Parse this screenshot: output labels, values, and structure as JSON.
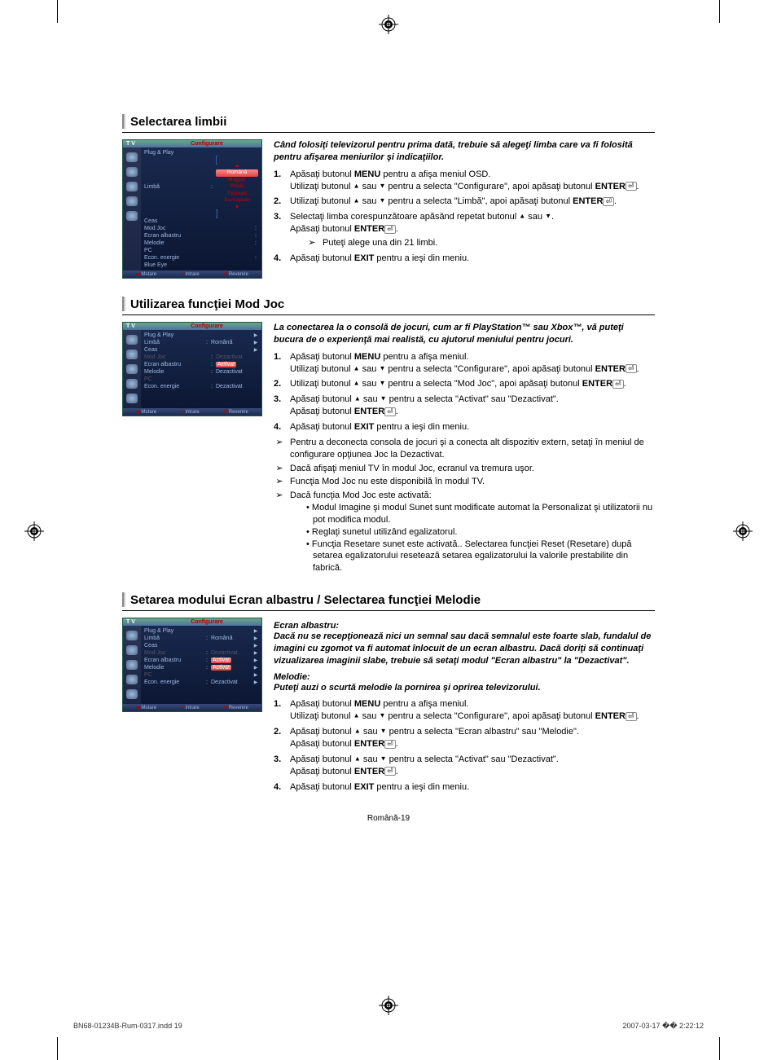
{
  "sections": {
    "s1": {
      "title": "Selectarea limbii",
      "intro": "Când folosiţi televizorul pentru prima dată, trebuie să alegeţi limba care va fi folosită pentru afişarea meniurilor şi indicaţiilor.",
      "step1a": "Apăsaţi butonul ",
      "step1b": " pentru a afişa meniul OSD.",
      "step1c": "Utilizaţi butonul ",
      "step1d": " sau ",
      "step1e": " pentru a selecta \"Configurare\", apoi apăsaţi butonul ",
      "step2a": "Utilizaţi butonul ",
      "step2b": " sau ",
      "step2c": " pentru a selecta \"Limbă\", apoi apăsaţi butonul ",
      "step3a": "Selectaţi limba corespunzătoare apăsând repetat butonul ",
      "step3b": " sau ",
      "step3c": ".",
      "step3d": "Apăsaţi butonul ",
      "step3note": "Puteţi alege una din 21 limbi.",
      "step4a": "Apăsaţi butonul ",
      "step4b": " pentru a ieşi din meniu.",
      "tv": {
        "header_left": "T V",
        "header_right": "Configurare",
        "plug": "Plug & Play",
        "limba": "Limbă",
        "ceas": "Ceas",
        "modjoc": "Mod Joc",
        "ecran": "Ecran albastru",
        "melodie": "Melodie",
        "pc": "PC",
        "econ": "Econ. energie",
        "blue": "Blue Eye",
        "dd_arrow": "▲",
        "dd_romana": "Română",
        "dd_magyar": "Magyar",
        "dd_polski": "Polski",
        "dd_russkii": "Русский",
        "dd_bulg": "Български",
        "dd_arrow2": "▼",
        "foot_move": "Mutare",
        "foot_enter": "Intrare",
        "foot_return": "Revenire"
      }
    },
    "s2": {
      "title": "Utilizarea funcţiei Mod Joc",
      "intro": "La conectarea la o consolă de jocuri, cum ar fi PlayStation™ sau Xbox™, vă puteţi bucura de o experienţă mai realistă, cu ajutorul meniului pentru jocuri.",
      "step1a": "Apăsaţi butonul ",
      "step1b": " pentru a afişa meniul.",
      "step1c": "Utilizaţi butonul ",
      "step1d": " sau ",
      "step1e": " pentru a selecta \"Configurare\", apoi apăsaţi butonul ",
      "step2a": "Utilizaţi butonul ",
      "step2b": " sau ",
      "step2c": " pentru a selecta \"Mod Joc\", apoi apăsaţi butonul ",
      "step3a": "Apăsaţi butonul ",
      "step3b": " sau ",
      "step3c": " pentru a selecta \"Activat\" sau \"Dezactivat\".",
      "step3d": "Apăsaţi butonul ",
      "step4a": "Apăsaţi butonul ",
      "step4b": " pentru a ieşi din meniu.",
      "note1": "Pentru a deconecta consola de jocuri şi a conecta alt dispozitiv extern, setaţi în meniul de configurare opţiunea Joc la Dezactivat.",
      "note2": "Dacă afişaţi meniul TV în modul Joc, ecranul va tremura uşor.",
      "note3": "Funcţia Mod Joc nu este disponibilă în modul TV.",
      "note4": "Dacă funcţia Mod Joc este activată:",
      "b1": "• Modul Imagine şi modul Sunet sunt modificate automat la Personalizat şi utilizatorii nu pot modifica modul.",
      "b2": "• Reglaţi sunetul utilizând egalizatorul.",
      "b3": "• Funcţia Resetare sunet este activată.. Selectarea funcţiei Reset (Resetare) după setarea egalizatorului resetează setarea egalizatorului la valorile prestabilite din fabrică.",
      "tv": {
        "header_left": "T V",
        "header_right": "Configurare",
        "plug": "Plug & Play",
        "limba": "Limbă",
        "limba_v": "Română",
        "ceas": "Ceas",
        "modjoc": "Mod Joc",
        "modjoc_v_grey": "Dezactivat",
        "ecran": "Ecran albastru",
        "ecran_v": "Activat",
        "melodie": "Melodie",
        "melodie_v": "Dezactivat",
        "pc": "PC",
        "econ": "Econ. energie",
        "econ_v": "Dezactivat",
        "foot_move": "Mutare",
        "foot_enter": "Intrare",
        "foot_return": "Revenire"
      }
    },
    "s3": {
      "title": "Setarea modului Ecran albastru / Selectarea funcţiei Melodie",
      "label1": "Ecran albastru:",
      "intro1": "Dacă nu se recepţionează nici un semnal sau dacă semnalul este foarte slab, fundalul de imagini cu zgomot va fi automat înlocuit de un ecran albastru. Dacă  doriţi să continuaţi vizualizarea imaginii slabe, trebuie să setaţi modul \"Ecran albastru\" la \"Dezactivat\".",
      "label2": "Melodie:",
      "intro2": "Puteţi auzi o scurtă melodie la pornirea şi oprirea televizorului.",
      "step1a": "Apăsaţi butonul ",
      "step1b": " pentru a afişa meniul.",
      "step1c": "Utilizaţi butonul ",
      "step1d": " sau ",
      "step1e": " pentru a selecta \"Configurare\", apoi apăsaţi butonul ",
      "step2a": "Apăsaţi butonul ",
      "step2b": " sau ",
      "step2c": " pentru a selecta \"Ecran albastru\" sau \"Melodie\".",
      "step2d": "Apăsaţi butonul ",
      "step3a": "Apăsaţi butonul ",
      "step3b": " sau ",
      "step3c": " pentru a selecta \"Activat\" sau \"Dezactivat\".",
      "step3d": "Apăsaţi butonul ",
      "step4a": "Apăsaţi butonul ",
      "step4b": " pentru a ieşi din meniu.",
      "tv": {
        "header_left": "T V",
        "header_right": "Configurare",
        "plug": "Plug & Play",
        "limba": "Limbă",
        "limba_v": "Română",
        "ceas": "Ceas",
        "modjoc": "Mod Joc",
        "modjoc_v": "Dezactivat",
        "ecran": "Ecran albastru",
        "ecran_v": "Activat",
        "melodie": "Melodie",
        "melodie_v": "Activat",
        "pc": "PC",
        "econ": "Econ. energie",
        "econ_v": "Dezactivat",
        "foot_move": "Mutare",
        "foot_enter": "Intrare",
        "foot_return": "Revenire"
      }
    }
  },
  "labels": {
    "menu": "MENU",
    "enter": "ENTER",
    "exit": "EXIT"
  },
  "page_num": "Română-19",
  "footer_left": "BN68-01234B-Rum-0317.indd   19",
  "footer_right": "2007-03-17   �� 2:22:12"
}
